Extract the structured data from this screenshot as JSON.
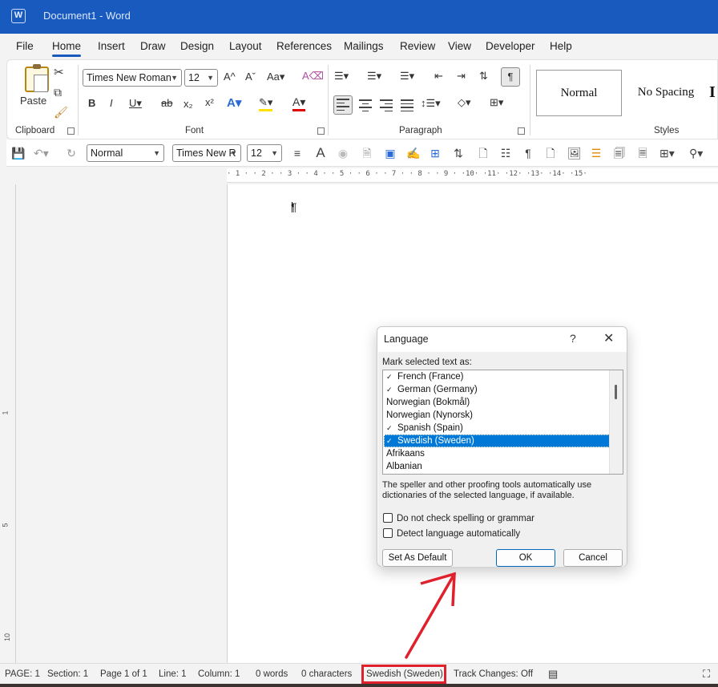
{
  "titlebar": {
    "title": "Document1  -  Word"
  },
  "menu": {
    "tabs": [
      "File",
      "Home",
      "Insert",
      "Draw",
      "Design",
      "Layout",
      "References",
      "Mailings",
      "Review",
      "View",
      "Developer",
      "Help"
    ],
    "active": "Home"
  },
  "ribbon": {
    "clipboard": {
      "paste_label": "Paste",
      "group_label": "Clipboard"
    },
    "font": {
      "family": "Times New Roman",
      "size": "12",
      "group_label": "Font"
    },
    "paragraph": {
      "group_label": "Paragraph"
    },
    "styles": {
      "normal": "Normal",
      "no_spacing": "No Spacing",
      "group_label": "Styles"
    }
  },
  "qat": {
    "style_value": "Normal",
    "font_value": "Times New R",
    "size_value": "12"
  },
  "ruler": {
    "numbers": "· 1 · · 2 · · 3 · · 4 · · 5 · · 6 · · 7 · · 8 · · 9 · ·10· ·11· ·12· ·13· ·14· ·15·"
  },
  "dialog": {
    "title": "Language",
    "help": "?",
    "close": "✕",
    "mark_label": "Mark selected text as:",
    "languages": [
      {
        "name": "French (France)",
        "spell": true,
        "selected": false
      },
      {
        "name": "German (Germany)",
        "spell": true,
        "selected": false
      },
      {
        "name": "Norwegian (Bokmål)",
        "spell": false,
        "selected": false
      },
      {
        "name": "Norwegian (Nynorsk)",
        "spell": false,
        "selected": false
      },
      {
        "name": "Spanish (Spain)",
        "spell": true,
        "selected": false
      },
      {
        "name": "Swedish (Sweden)",
        "spell": true,
        "selected": true
      },
      {
        "name": "Afrikaans",
        "spell": false,
        "selected": false
      },
      {
        "name": "Albanian",
        "spell": false,
        "selected": false
      }
    ],
    "info": "The speller and other proofing tools automatically use dictionaries of the selected language, if available.",
    "no_check_label": "Do not check spelling or grammar",
    "detect_label": "Detect language automatically",
    "set_default_label": "Set As Default",
    "ok_label": "OK",
    "cancel_label": "Cancel"
  },
  "statusbar": {
    "page": "PAGE: 1",
    "section": "Section: 1",
    "page_of": "Page 1 of 1",
    "line": "Line: 1",
    "column": "Column: 1",
    "words": "0 words",
    "characters": "0 characters",
    "language": "Swedish (Sweden)",
    "track_changes": "Track Changes: Off"
  },
  "colors": {
    "title_bar": "#185abd",
    "accent": "#0078d7",
    "annotation": "#e0202c"
  }
}
